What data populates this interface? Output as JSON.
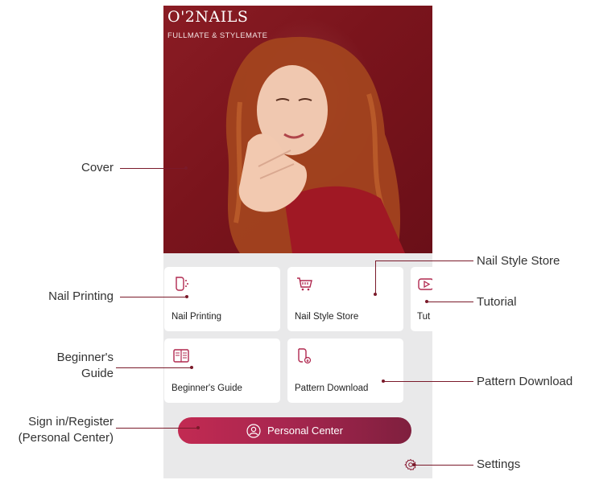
{
  "brand": {
    "title": "O'2NAILS",
    "subtitle": "FULLMATE & STYLEMATE"
  },
  "menu": [
    {
      "label": "Nail Printing",
      "icon": "nail-printing-icon"
    },
    {
      "label": "Nail Style Store",
      "icon": "cart-icon"
    },
    {
      "label": "Tut",
      "icon": "play-icon"
    },
    {
      "label": "Beginner's Guide",
      "icon": "book-icon"
    },
    {
      "label": "Pattern Download",
      "icon": "nail-download-icon"
    }
  ],
  "personal_center": {
    "label": "Personal Center",
    "icon": "user-icon"
  },
  "settings": {
    "icon": "settings-icon"
  },
  "annotations": {
    "cover": "Cover",
    "nail_printing": "Nail Printing",
    "beginners_guide_line1": "Beginner's",
    "beginners_guide_line2": "Guide",
    "sign_in_line1": "Sign in/Register",
    "sign_in_line2": "(Personal Center)",
    "nail_style_store": "Nail Style Store",
    "tutorial": "Tutorial",
    "pattern_download": "Pattern Download",
    "settings": "Settings"
  },
  "colors": {
    "cover_bg": "#7a141c",
    "accent": "#b0284f",
    "annotation_line": "#7a1a2a"
  }
}
